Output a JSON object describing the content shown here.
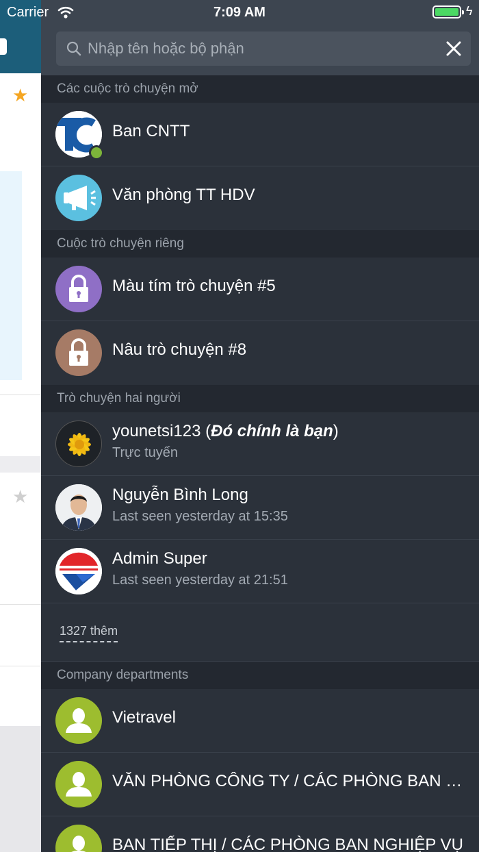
{
  "status_bar": {
    "carrier": "Carrier",
    "time": "7:09 AM"
  },
  "search": {
    "placeholder": "Nhập tên hoặc bộ phận"
  },
  "sections": {
    "open_chats": {
      "header": "Các cuộc trò chuyện mở",
      "items": [
        {
          "title": "Ban CNTT",
          "avatar": "logo-tc"
        },
        {
          "title": "Văn phòng TT HDV",
          "avatar": "megaphone-icon"
        }
      ]
    },
    "private_chats": {
      "header": "Cuộc trò chuyện riêng",
      "items": [
        {
          "title": "Màu tím trò chuyện #5",
          "avatar": "lock-icon",
          "color": "#8f6fc6"
        },
        {
          "title": "Nâu trò chuyện #8",
          "avatar": "lock-icon",
          "color": "#a67b66"
        }
      ]
    },
    "dialogs": {
      "header": "Trò chuyện hai người",
      "items": [
        {
          "title": "younetsi123",
          "you_label": "Đó chính là bạn",
          "subtitle": "Trực tuyến"
        },
        {
          "title": "Nguyễn Bình Long",
          "subtitle": "Last seen yesterday at 15:35"
        },
        {
          "title": "Admin Super",
          "subtitle": "Last seen yesterday at 21:51"
        }
      ],
      "more": "1327 thêm"
    },
    "departments": {
      "header": "Company departments",
      "items": [
        {
          "title": "Vietravel"
        },
        {
          "title": "VĂN PHÒNG CÔNG TY / CÁC PHÒNG BAN NGHIỆP VỤ"
        },
        {
          "title": "BAN TIẾP THỊ / CÁC PHÒNG BAN NGHIỆP VỤ"
        }
      ]
    }
  },
  "colors": {
    "drawer_bg": "#2b313a",
    "section_bg": "#232830",
    "accent_green": "#9dbd2f",
    "header_blue": "#1c5e7a"
  }
}
